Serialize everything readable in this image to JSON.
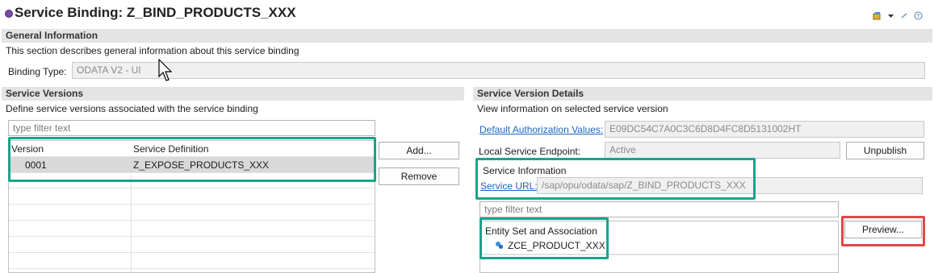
{
  "header": {
    "title": "Service Binding: Z_BIND_PRODUCTS_XXX",
    "icon": "service-binding-icon"
  },
  "general": {
    "heading": "General Information",
    "description": "This section describes general information about this service binding",
    "binding_type_label": "Binding Type:",
    "binding_type_value": "ODATA V2 - UI"
  },
  "versions": {
    "heading": "Service Versions",
    "description": "Define service versions associated with the service binding",
    "filter_placeholder": "type filter text",
    "columns": [
      "Version",
      "Service Definition"
    ],
    "rows": [
      {
        "version": "0001",
        "definition": "Z_EXPOSE_PRODUCTS_XXX"
      }
    ],
    "add_label": "Add...",
    "remove_label": "Remove"
  },
  "details": {
    "heading": "Service Version Details",
    "description": "View information on selected service version",
    "auth_link": "Default Authorization Values:",
    "auth_value": "E09DC54C7A0C3C6D8D4FC8D5131002HT",
    "endpoint_label": "Local Service Endpoint:",
    "endpoint_value": "Active",
    "unpublish_label": "Unpublish",
    "service_info_label": "Service Information",
    "service_url_link": "Service URL:",
    "service_url_value": "/sap/opu/odata/sap/Z_BIND_PRODUCTS_XXX",
    "filter_placeholder": "type filter text",
    "entity_heading": "Entity Set and Association",
    "entity_item": "ZCE_PRODUCT_XXX",
    "preview_label": "Preview..."
  },
  "colors": {
    "highlight_green": "#17a48c",
    "highlight_red": "#e04848",
    "link": "#1a66c2"
  }
}
